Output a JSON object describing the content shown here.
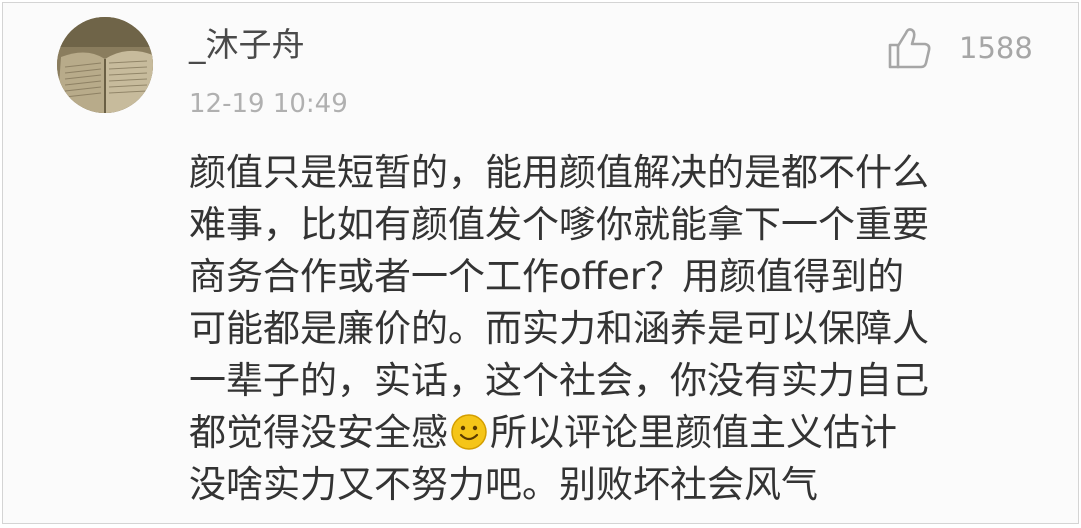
{
  "comment": {
    "username": "_沐子舟",
    "timestamp": "12-19 10:49",
    "like_count": "1588",
    "avatar_icon": "avatar-book-photo",
    "like_icon": "thumbs-up-icon",
    "emoji_icon": "smiley-emoji-icon",
    "lines": [
      "颜值只是短暂的，能用颜值解决的是都不什么",
      "难事，比如有颜值发个嗲你就能拿下一个重要",
      "商务合作或者一个工作offer？用颜值得到的",
      "可能都是廉价的。而实力和涵养是可以保障人",
      "一辈子的，实话，这个社会，你没有实力自己",
      "所以评论里颜值主义估计",
      "没啥实力又不努力吧。别败坏社会风气"
    ],
    "line6_before_emoji": "都觉得没安全感"
  },
  "colors": {
    "background": "#fbfbfb",
    "username": "#4a4a4a",
    "timestamp": "#b0b0b0",
    "like": "#a6a6a6",
    "text": "#333333",
    "emoji": "#f5c518"
  }
}
